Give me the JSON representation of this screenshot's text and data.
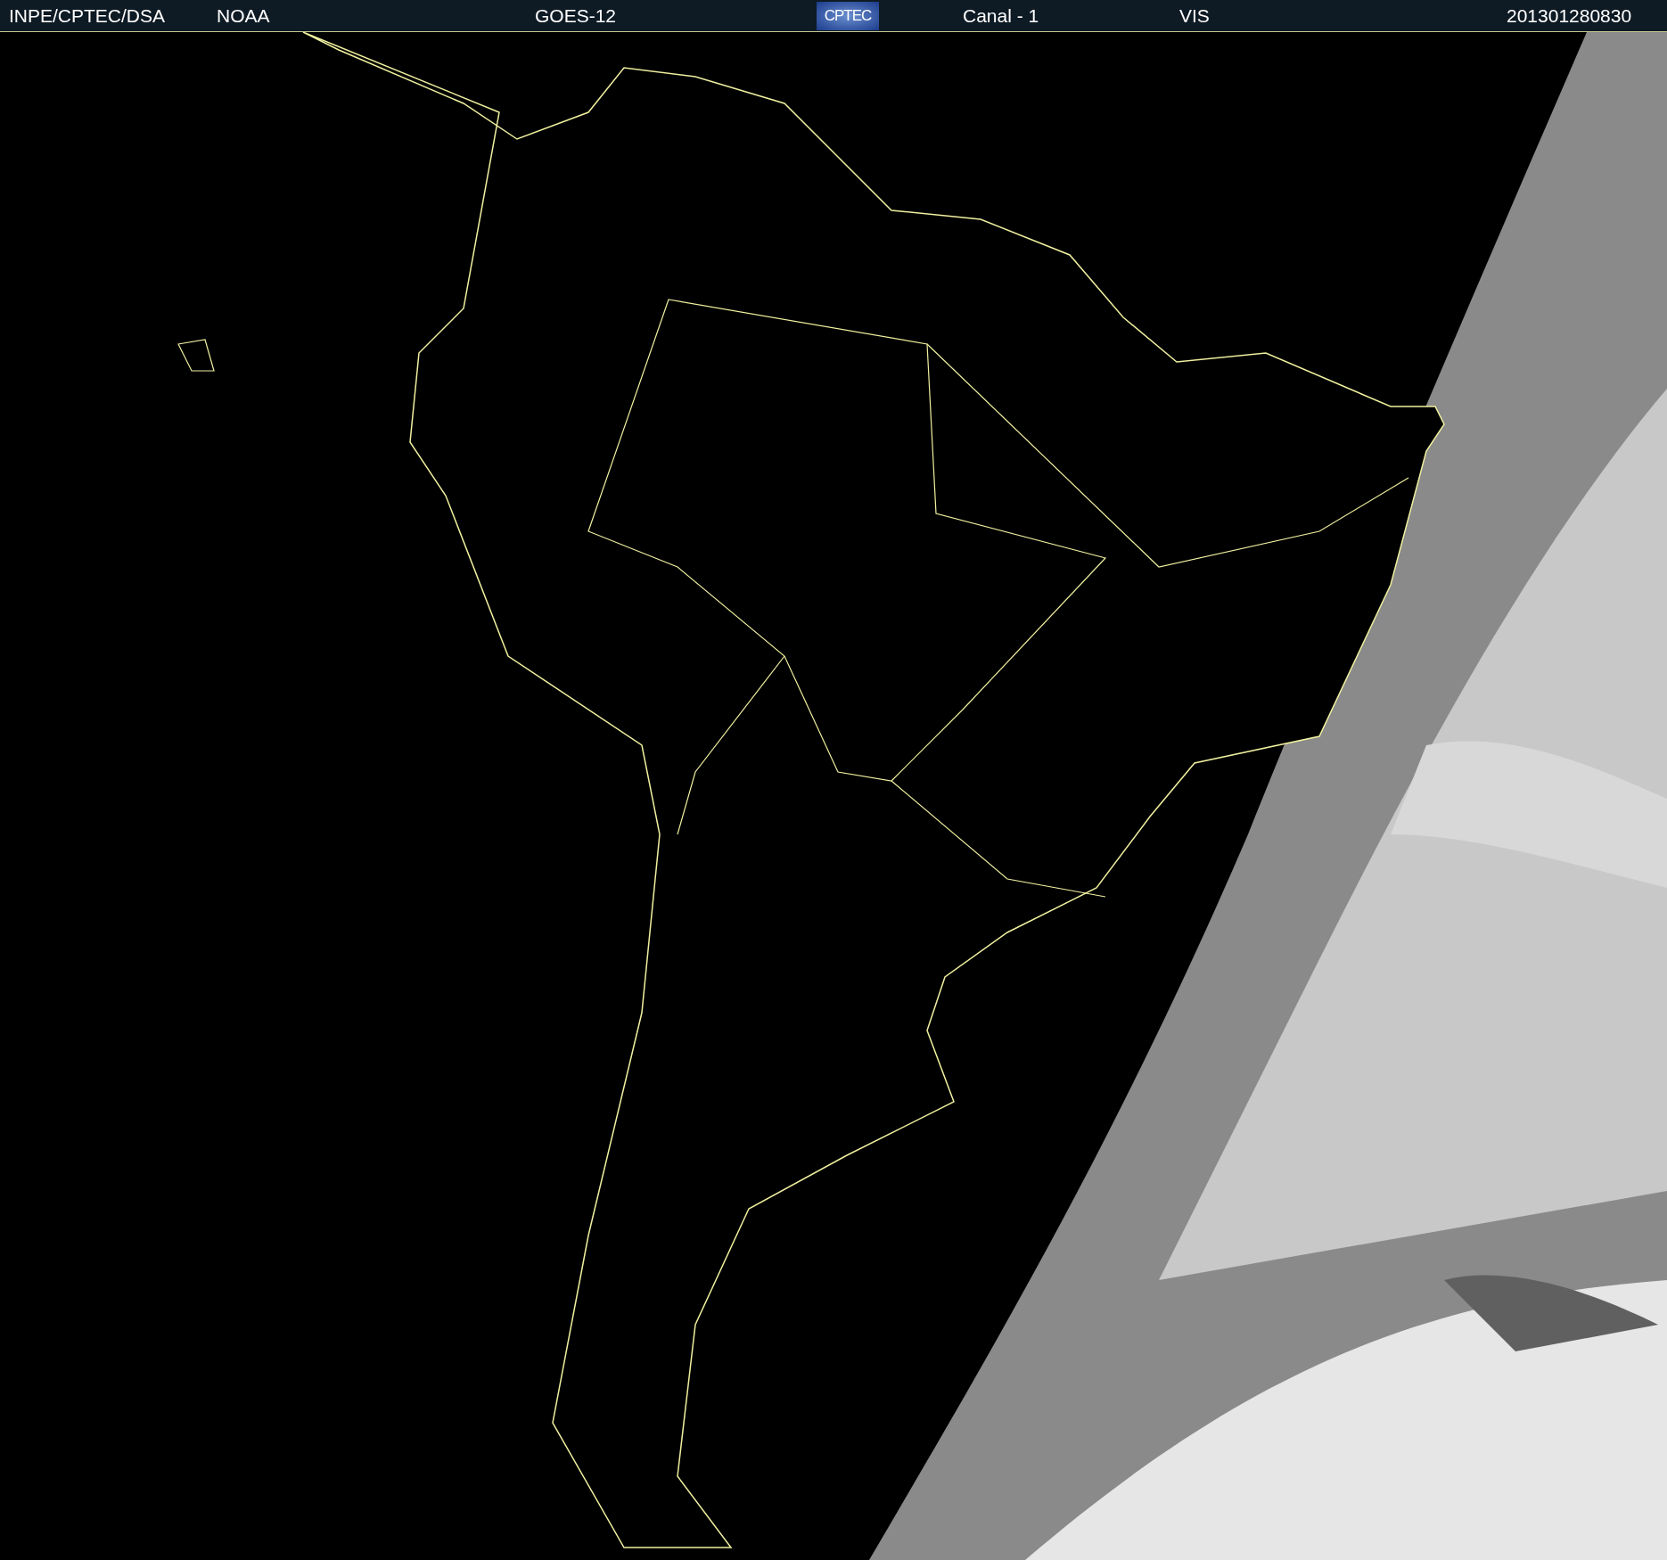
{
  "header": {
    "source": "INPE/CPTEC/DSA",
    "agency": "NOAA",
    "satellite": "GOES-12",
    "logo": "CPTEC",
    "channel": "Canal - 1",
    "band": "VIS",
    "timestamp": "201301280830"
  }
}
